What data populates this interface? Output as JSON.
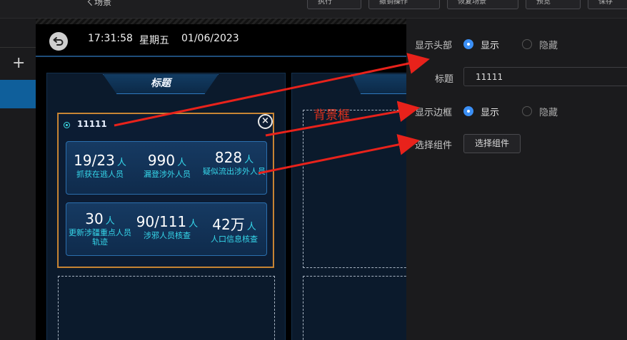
{
  "toolbar": {
    "crumb": "ㄑ场景",
    "buttons": [
      "执行",
      "撤销操作",
      "恢复场景",
      "预览",
      "保存"
    ]
  },
  "sidebar": {
    "add_symbol": "+"
  },
  "header": {
    "time": "17:31:58",
    "weekday": "星期五",
    "date": "01/06/2023"
  },
  "panels": [
    {
      "tab_title": "标题"
    },
    {
      "tab_title": "标"
    }
  ],
  "widget": {
    "title": "11111",
    "close_symbol": "×",
    "stats": [
      {
        "value": "19/23",
        "unit": "人",
        "label": "抓获在逃人员"
      },
      {
        "value": "990",
        "unit": "人",
        "label": "漏登涉外人员"
      },
      {
        "value": "828",
        "unit": "人",
        "label": "疑似流出涉外人员"
      },
      {
        "value": "30",
        "unit": "人",
        "label": "更新涉疆重点人员轨迹"
      },
      {
        "value": "90/111",
        "unit": "人",
        "label": "涉邪人员核查"
      },
      {
        "value": "42万",
        "unit": "人",
        "label": "人口信息核查"
      }
    ]
  },
  "annotation_label": "背景框",
  "properties": {
    "show_header_label": "显示头部",
    "show_option": "显示",
    "hide_option": "隐藏",
    "title_label": "标题",
    "title_value": "11111",
    "show_border_label": "显示边框",
    "select_component_label": "选择组件",
    "select_component_button": "选择组件"
  },
  "colors": {
    "accent_blue": "#3b8ff5",
    "stat_cyan": "#36d7ea",
    "widget_border": "#d58f3a",
    "annotation_red": "#e0321e"
  }
}
